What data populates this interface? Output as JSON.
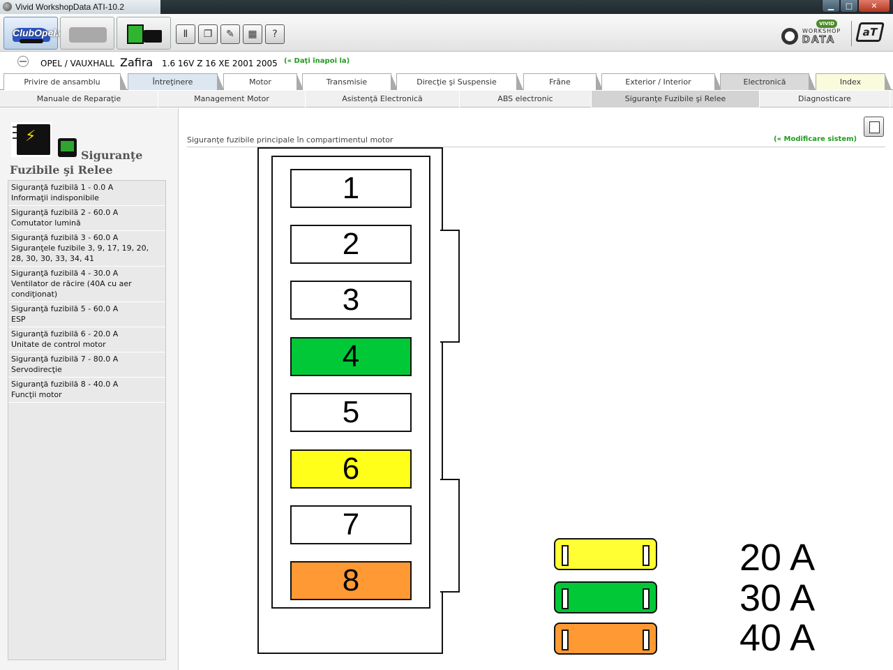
{
  "window": {
    "title": "Vivid WorkshopData ATI-10.2",
    "min_glyph": "▁",
    "max_glyph": "□",
    "close_glyph": "✕"
  },
  "toolbar": {
    "watermark": "ClubOpel.com",
    "tools": [
      "info-icon",
      "copy-icon",
      "edit-icon",
      "calculator-icon",
      "help-icon"
    ],
    "tool_glyphs": [
      "Ⅱ",
      "❐",
      "✎",
      "▦",
      "?"
    ],
    "logo_vivid": "VIVID",
    "logo_workshop": "WORKSHOP",
    "logo_data": "DATA",
    "logo_ati": "aT"
  },
  "vehicle": {
    "make": "OPEL / VAUXHALL",
    "model": "Zafira",
    "spec": "1.6 16V Z 16 XE 2001 2005",
    "back_link": "(« Daţi înapoi la)"
  },
  "category_tabs": [
    {
      "label": "Privire de ansamblu"
    },
    {
      "label": "Întreţinere"
    },
    {
      "label": "Motor"
    },
    {
      "label": "Transmisie"
    },
    {
      "label": "Direcţie şi Suspensie"
    },
    {
      "label": "Frâne"
    },
    {
      "label": "Exterior / Interior"
    },
    {
      "label": "Electronică"
    },
    {
      "label": "Index"
    }
  ],
  "sub_tabs": [
    {
      "label": "Manuale de Reparaţie"
    },
    {
      "label": "Management Motor"
    },
    {
      "label": "Asistenţă Electronică"
    },
    {
      "label": "ABS electronic"
    },
    {
      "label": "Siguranţe Fuzibile şi Relee"
    },
    {
      "label": "Diagnosticare"
    }
  ],
  "left_panel": {
    "title_line1": "Siguranţe",
    "title_line2": "Fuzibile şi Relee",
    "fuses": [
      {
        "line1": "Siguranţă fuzibilă 1 - 0.0 A",
        "line2": "Informaţii indisponibile"
      },
      {
        "line1": "Siguranţă fuzibilă 2 - 60.0 A",
        "line2": "Comutator lumină"
      },
      {
        "line1": "Siguranţă fuzibilă 3 - 60.0 A",
        "line2": "Siguranţele fuzibile 3, 9, 17, 19, 20, 28, 30, 30, 33, 34, 41"
      },
      {
        "line1": "Siguranţă fuzibilă 4 - 30.0 A",
        "line2": "Ventilator de răcire (40A cu aer condiţionat)"
      },
      {
        "line1": "Siguranţă fuzibilă 5 - 60.0 A",
        "line2": "ESP"
      },
      {
        "line1": "Siguranţă fuzibilă 6 - 20.0 A",
        "line2": "Unitate de control motor"
      },
      {
        "line1": "Siguranţă fuzibilă 7 - 80.0 A",
        "line2": "Servodirecţie"
      },
      {
        "line1": "Siguranţă fuzibilă 8 - 40.0 A",
        "line2": "Funcţii motor"
      }
    ]
  },
  "content": {
    "title": "Siguranţe fuzibile principale în compartimentul motor",
    "modify_link": "(« Modificare sistem)",
    "slots": [
      {
        "label": "1",
        "color": "#ffffff"
      },
      {
        "label": "2",
        "color": "#ffffff"
      },
      {
        "label": "3",
        "color": "#ffffff"
      },
      {
        "label": "4",
        "color": "#00c837"
      },
      {
        "label": "5",
        "color": "#ffffff"
      },
      {
        "label": "6",
        "color": "#ffff19"
      },
      {
        "label": "7",
        "color": "#ffffff"
      },
      {
        "label": "8",
        "color": "#ff9933"
      }
    ],
    "legend": [
      {
        "label": "20 A",
        "color": "#ffff33"
      },
      {
        "label": "30 A",
        "color": "#00c837"
      },
      {
        "label": "40 A",
        "color": "#ff9933"
      }
    ]
  }
}
